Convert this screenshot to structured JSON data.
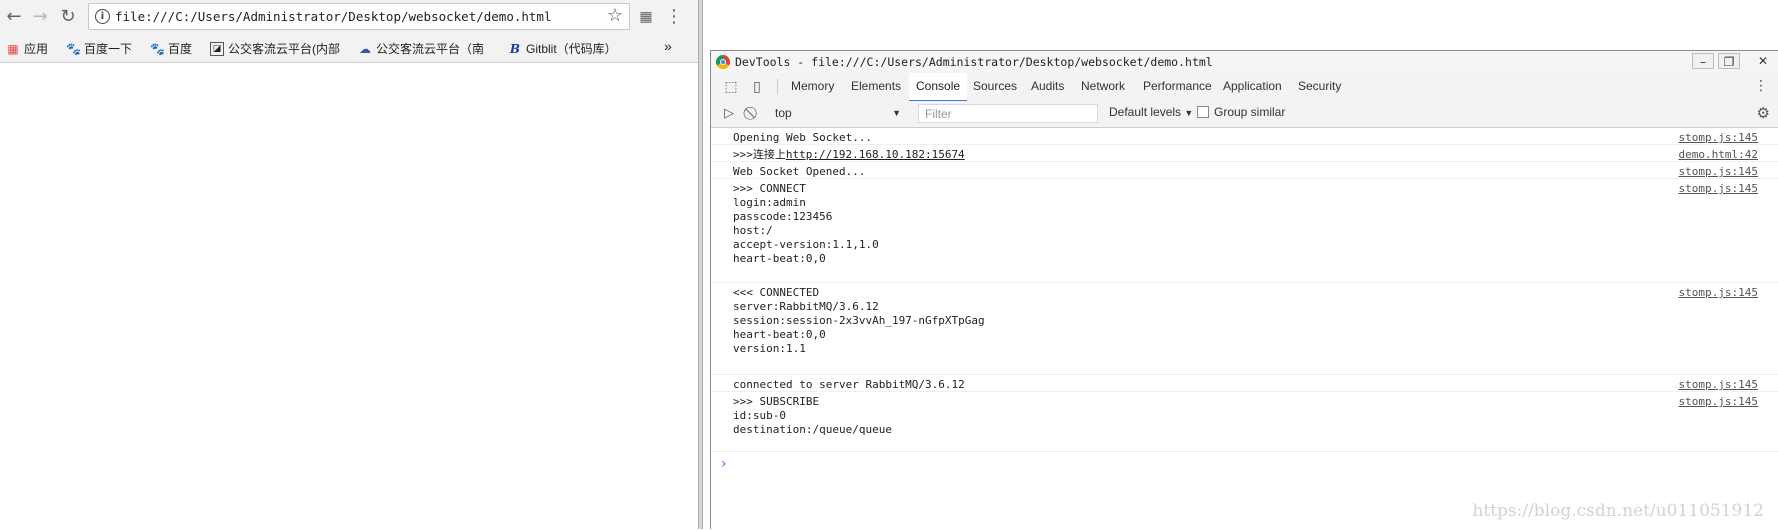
{
  "browser": {
    "url": "file:///C:/Users/Administrator/Desktop/websocket/demo.html",
    "bookmarks": [
      {
        "label": "应用",
        "icon": "apps-grid-icon"
      },
      {
        "label": "百度一下",
        "icon": "baidu-paw-icon"
      },
      {
        "label": "百度",
        "icon": "baidu-paw-icon"
      },
      {
        "label": "公交客流云平台(内部",
        "icon": "chart-page-icon"
      },
      {
        "label": "公交客流云平台（南",
        "icon": "cloud-icon"
      },
      {
        "label": "Gitblit（代码库）",
        "icon": "gitblit-icon"
      }
    ],
    "more_bookmarks": "»"
  },
  "devtools": {
    "title": "DevTools - file:///C:/Users/Administrator/Desktop/websocket/demo.html",
    "tabs": [
      "Memory",
      "Elements",
      "Console",
      "Sources",
      "Audits",
      "Network",
      "Performance",
      "Application",
      "Security"
    ],
    "active_tab": "Console",
    "context": "top",
    "filter_placeholder": "Filter",
    "levels": "Default levels",
    "group_similar": "Group similar"
  },
  "console": {
    "messages": [
      {
        "text": "Opening Web Socket...",
        "source": "stomp.js:145"
      },
      {
        "prefix": ">>>连接上",
        "link": "http://192.168.10.182:15674",
        "source": "demo.html:42"
      },
      {
        "text": "Web Socket Opened...",
        "source": "stomp.js:145"
      },
      {
        "text": ">>> CONNECT\nlogin:admin\npasscode:123456\nhost:/\naccept-version:1.1,1.0\nheart-beat:0,0",
        "source": "stomp.js:145"
      },
      {
        "text": "<<< CONNECTED\nserver:RabbitMQ/3.6.12\nsession:session-2x3vvAh_197-nGfpXTpGag\nheart-beat:0,0\nversion:1.1",
        "source": "stomp.js:145"
      },
      {
        "text": "connected to server RabbitMQ/3.6.12",
        "source": "stomp.js:145"
      },
      {
        "text": ">>> SUBSCRIBE\nid:sub-0\ndestination:/queue/queue",
        "source": "stomp.js:145"
      }
    ]
  },
  "watermark": "https://blog.csdn.net/u011051912"
}
